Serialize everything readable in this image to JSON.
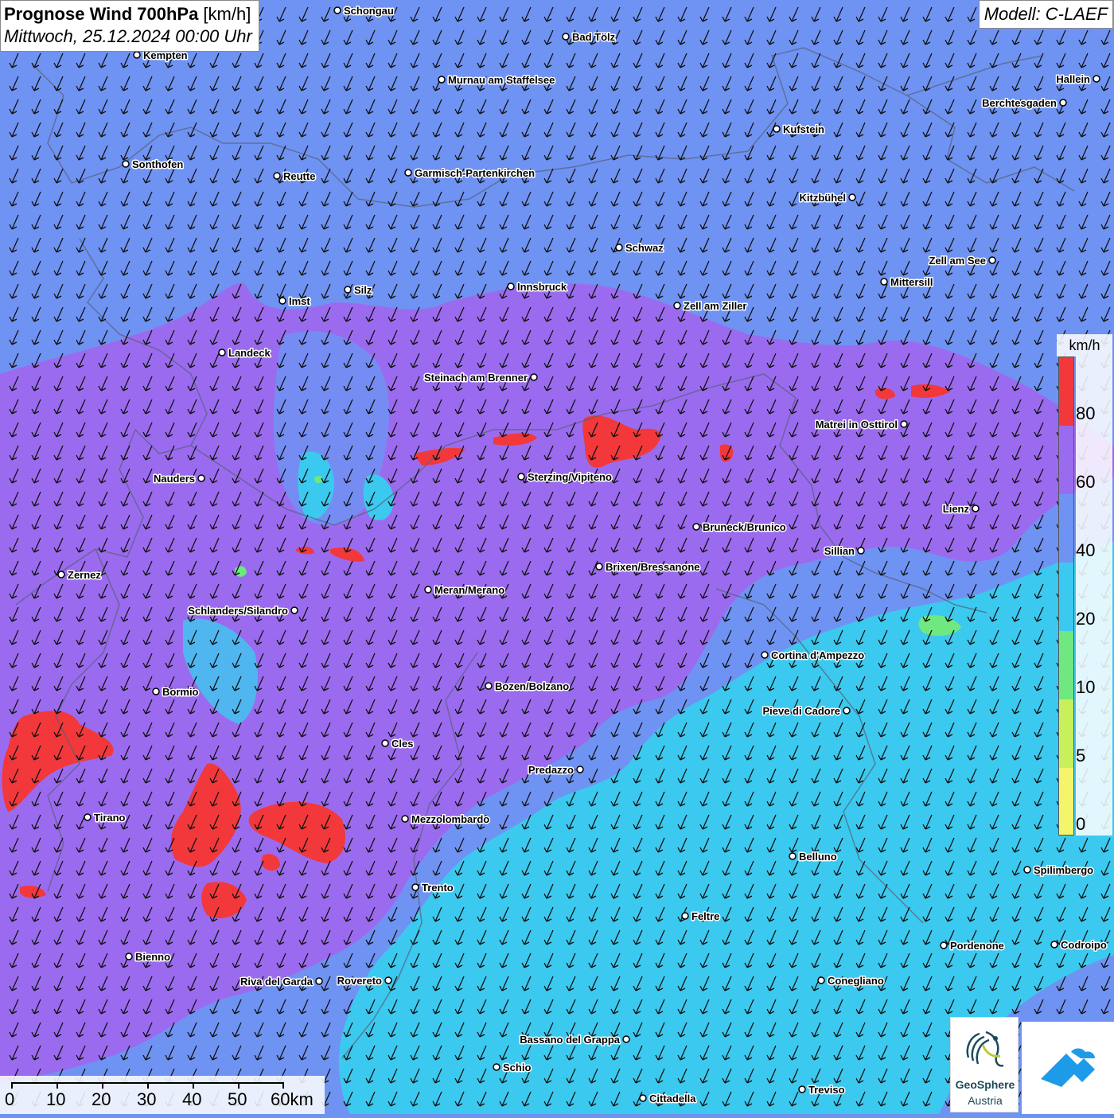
{
  "header": {
    "title_bold": "Prognose Wind 700hPa",
    "title_unit": " [km/h]",
    "subtitle": "Mittwoch, 25.12.2024 00:00 Uhr",
    "model": "Modell: C-LAEF"
  },
  "legend": {
    "unit": "km/h",
    "ticks": [
      "80",
      "60",
      "40",
      "20",
      "10",
      "5",
      "0"
    ],
    "colors": [
      "#f2383a",
      "#9b6bef",
      "#6f93f2",
      "#3cc9ef",
      "#6fe87f",
      "#c8f05a",
      "#f5f56b"
    ]
  },
  "scale": {
    "labels": [
      "0",
      "10",
      "20",
      "30",
      "40",
      "50",
      "60km"
    ]
  },
  "logos": {
    "geosphere_line1": "GeoSphere",
    "geosphere_line2": "Austria"
  },
  "cities": [
    {
      "name": "Schongau"
    },
    {
      "name": "Bad Tölz"
    },
    {
      "name": "Kempten"
    },
    {
      "name": "Murnau am Staffelsee"
    },
    {
      "name": "Hallein"
    },
    {
      "name": "Berchtesgaden"
    },
    {
      "name": "Kufstein"
    },
    {
      "name": "Sonthofen"
    },
    {
      "name": "Reutte"
    },
    {
      "name": "Garmisch-Partenkirchen"
    },
    {
      "name": "Kitzbühel"
    },
    {
      "name": "Schwaz"
    },
    {
      "name": "Zell am See"
    },
    {
      "name": "Mittersill"
    },
    {
      "name": "Imst"
    },
    {
      "name": "Silz"
    },
    {
      "name": "Innsbruck"
    },
    {
      "name": "Zell am Ziller"
    },
    {
      "name": "Landeck"
    },
    {
      "name": "Steinach am Brenner"
    },
    {
      "name": "Matrei in Osttirol"
    },
    {
      "name": "Nauders"
    },
    {
      "name": "Sterzing/Vipiteno"
    },
    {
      "name": "Lienz"
    },
    {
      "name": "Bruneck/Brunico"
    },
    {
      "name": "Sillian"
    },
    {
      "name": "Zernez"
    },
    {
      "name": "Brixen/Bressanone"
    },
    {
      "name": "Meran/Merano"
    },
    {
      "name": "Schlanders/Silandro"
    },
    {
      "name": "Cortina d'Ampezzo"
    },
    {
      "name": "Bozen/Bolzano"
    },
    {
      "name": "Bormio"
    },
    {
      "name": "Pieve di Cadore"
    },
    {
      "name": "Cles"
    },
    {
      "name": "Predazzo"
    },
    {
      "name": "Tirano"
    },
    {
      "name": "Mezzolombardo"
    },
    {
      "name": "Belluno"
    },
    {
      "name": "Spilimbergo"
    },
    {
      "name": "Trento"
    },
    {
      "name": "Feltre"
    },
    {
      "name": "Pordenone"
    },
    {
      "name": "Codroipo"
    },
    {
      "name": "Bienno"
    },
    {
      "name": "Riva del Garda"
    },
    {
      "name": "Rovereto"
    },
    {
      "name": "Conegliano"
    },
    {
      "name": "Bassano del Grappa"
    },
    {
      "name": "Schio"
    },
    {
      "name": "Treviso"
    },
    {
      "name": "Cittadella"
    }
  ]
}
